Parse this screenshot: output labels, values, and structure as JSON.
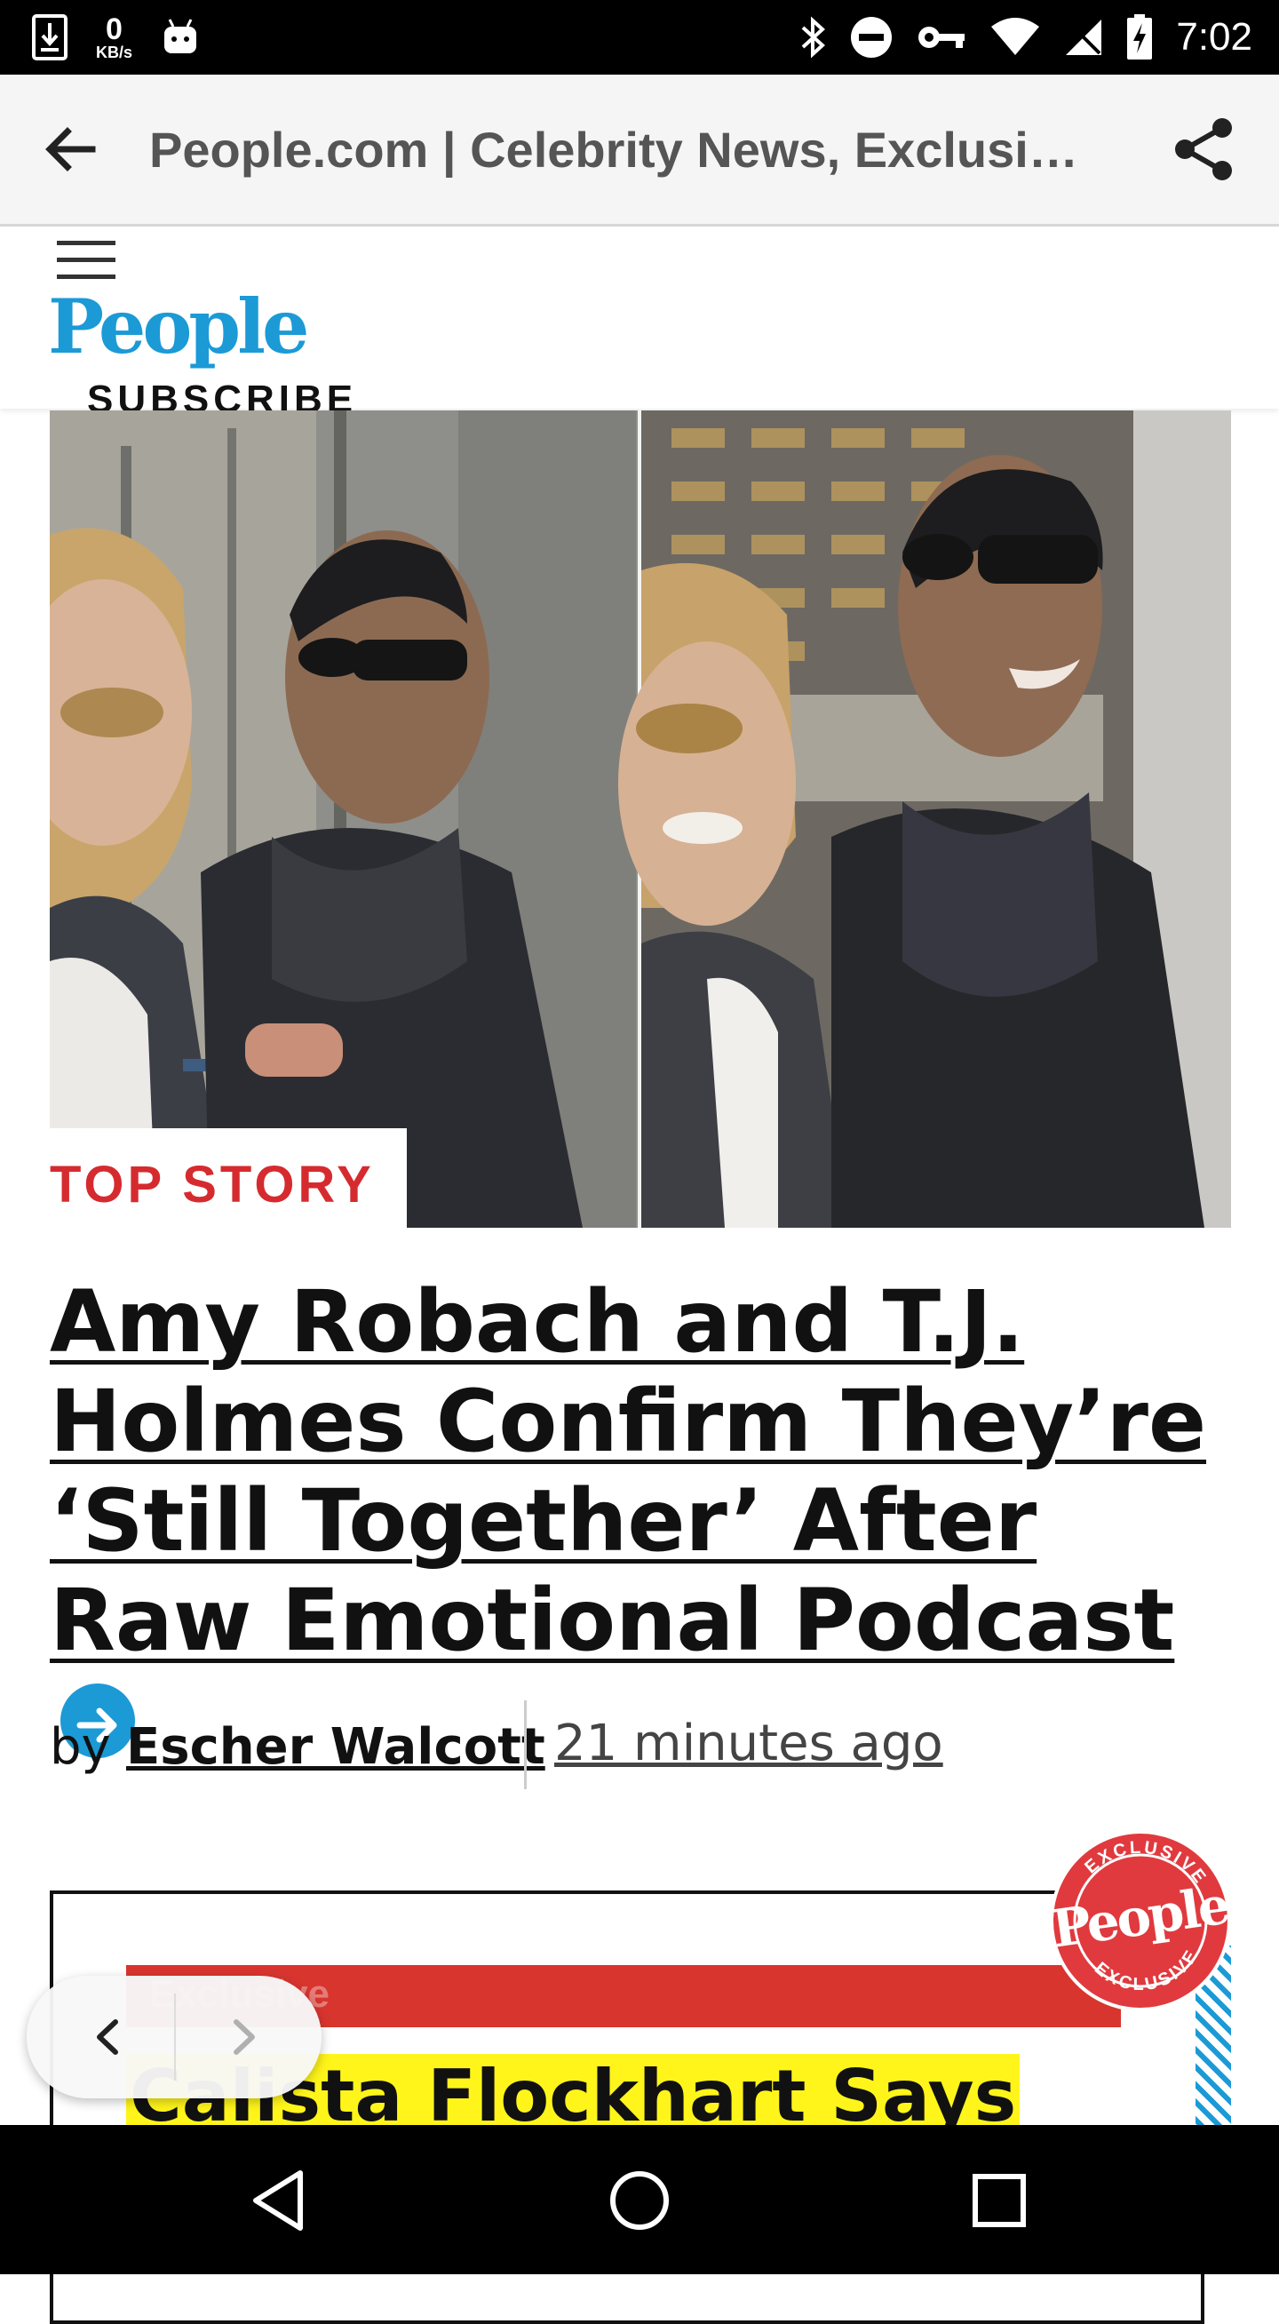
{
  "status_bar": {
    "net_speed_value": "0",
    "net_speed_unit": "KB/s",
    "time": "7:02",
    "icons": [
      "download-icon",
      "android-icon",
      "bluetooth-icon",
      "do-not-disturb-icon",
      "vpn-key-icon",
      "wifi-icon",
      "signal-icon",
      "battery-charging-icon"
    ]
  },
  "app_bar": {
    "title": "People.com | Celebrity News, Exclusi…",
    "back_icon": "arrow-back-icon",
    "share_icon": "share-icon"
  },
  "site_header": {
    "menu_icon": "hamburger-menu-icon",
    "logo_text": "People",
    "subscribe_label": "SUBSCRIBE",
    "logo_color": "#1b9ad6"
  },
  "article": {
    "label": "TOP STORY",
    "headline": "Amy Robach and T.J. Holmes Confirm They’re ‘Still Together’ After Raw Emotional Podcast",
    "by": "by",
    "author": "Escher Walcott",
    "time": "21 minutes ago",
    "label_color": "#d52b2f"
  },
  "card": {
    "bar_text": "Exclusive",
    "title": "Calista Flockhart Says",
    "badge_text": "People",
    "badge_ring_text": "EXCLUSIVE"
  },
  "floating_nav": {
    "prev_icon": "chevron-left-icon",
    "next_icon": "chevron-right-icon"
  },
  "nav_bar": {
    "icons": [
      "back-triangle-icon",
      "home-circle-icon",
      "recents-square-icon"
    ]
  }
}
